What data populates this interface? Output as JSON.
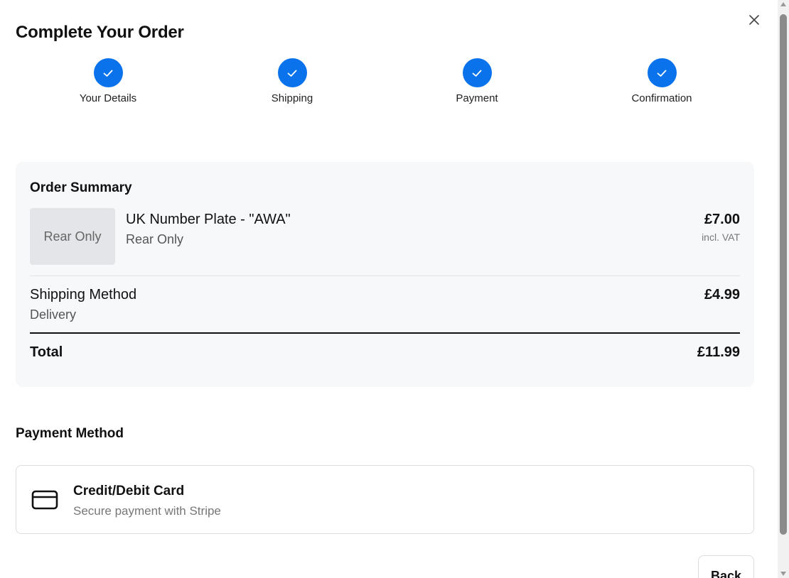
{
  "header": {
    "title": "Complete Your Order",
    "close_icon": "close-icon"
  },
  "steps": [
    {
      "label": "Your Details",
      "status": "complete",
      "icon": "check-icon"
    },
    {
      "label": "Shipping",
      "status": "complete",
      "icon": "check-icon"
    },
    {
      "label": "Payment",
      "status": "complete",
      "icon": "check-icon"
    },
    {
      "label": "Confirmation",
      "status": "complete",
      "icon": "check-icon"
    }
  ],
  "order_summary": {
    "heading": "Order Summary",
    "item": {
      "thumbnail_text": "Rear Only",
      "name": "UK Number Plate - \"AWA\"",
      "variant": "Rear Only",
      "price": "£7.00",
      "vat_note": "incl. VAT"
    },
    "shipping": {
      "label": "Shipping Method",
      "method": "Delivery",
      "price": "£4.99"
    },
    "total": {
      "label": "Total",
      "price": "£11.99"
    }
  },
  "payment": {
    "heading": "Payment Method",
    "option": {
      "icon": "credit-card-icon",
      "title": "Credit/Debit Card",
      "subtitle": "Secure payment with Stripe"
    }
  },
  "footer": {
    "back_label": "Back"
  },
  "colors": {
    "accent": "#0a73eb",
    "summary_bg": "#f7f8fa",
    "thumb_bg": "#e4e5e8",
    "text": "#111111",
    "muted": "#777777"
  }
}
